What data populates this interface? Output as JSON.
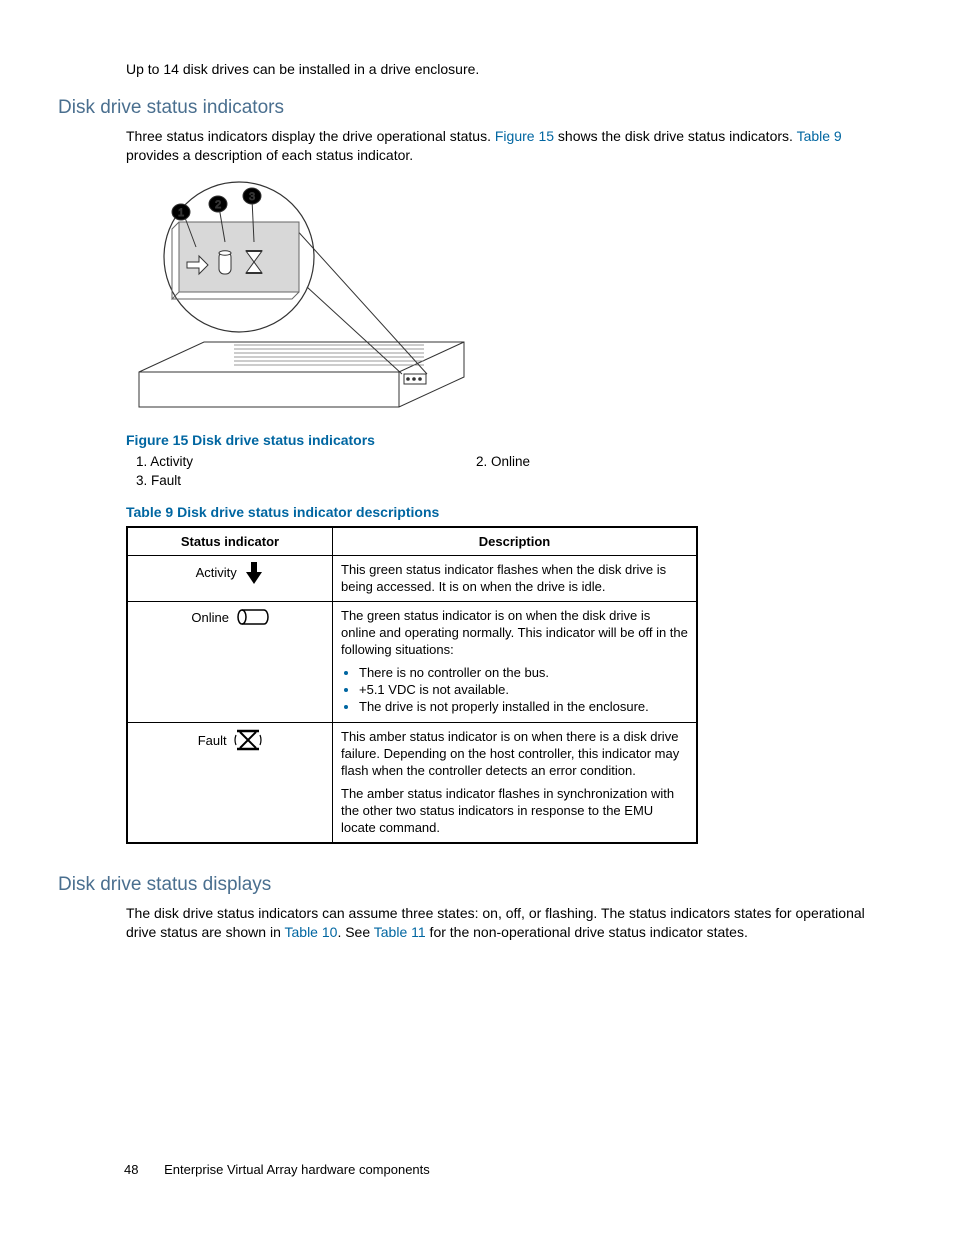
{
  "intro": "Up to 14 disk drives can be installed in a drive enclosure.",
  "section1": {
    "heading": "Disk drive status indicators",
    "para_a": "Three status indicators display the drive operational status.  ",
    "link1": "Figure 15",
    "para_b": " shows the disk drive status indicators.  ",
    "link2": "Table 9",
    "para_c": " provides a description of each status indicator."
  },
  "figure15": {
    "caption": "Figure 15 Disk drive status indicators",
    "legend": {
      "i1": "1.  Activity",
      "i2": "2.  Online",
      "i3": "3.  Fault"
    }
  },
  "table9": {
    "caption": "Table 9 Disk drive status indicator descriptions",
    "head": {
      "c1": "Status indicator",
      "c2": "Description"
    },
    "rows": {
      "r1": {
        "label": "Activity",
        "desc": "This green status indicator flashes when the disk drive is being accessed.  It is on when the drive is idle."
      },
      "r2": {
        "label": "Online",
        "desc": "The green status indicator is on when the disk drive is online and operating normally.  This indicator will be off in the following situations:",
        "b1": "There is no controller on the bus.",
        "b2": "+5.1 VDC is not available.",
        "b3": "The drive is not properly installed in the enclosure."
      },
      "r3": {
        "label": "Fault",
        "desc1": "This amber status indicator is on when there is a disk drive failure.  Depending on the host controller, this indicator may flash when the controller detects an error condition.",
        "desc2": "The amber status indicator flashes in synchronization with the other two status indicators in response to the EMU locate command."
      }
    }
  },
  "section2": {
    "heading": "Disk drive status displays",
    "para_a": "The disk drive status indicators can assume three states:  on, off, or flashing.  The status indicators states for operational drive status are shown in ",
    "link1": "Table 10",
    "para_b": ".  See ",
    "link2": "Table 11",
    "para_c": " for the non-operational drive status indicator states."
  },
  "footer": {
    "page": "48",
    "title": "Enterprise Virtual Array hardware components"
  }
}
